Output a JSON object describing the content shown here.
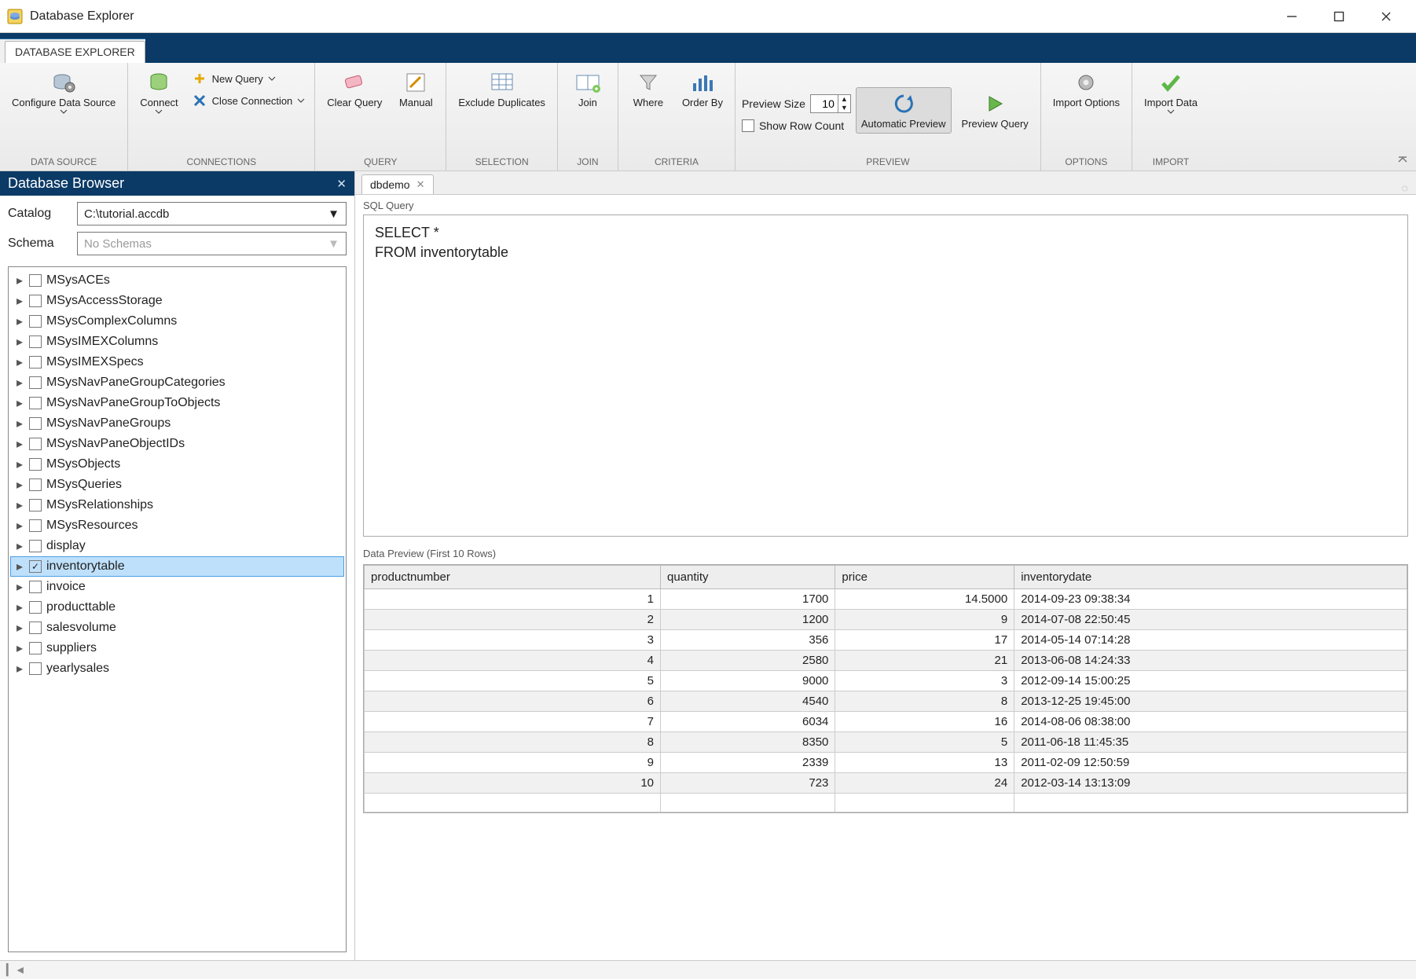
{
  "window": {
    "title": "Database Explorer"
  },
  "main_tab": "DATABASE EXPLORER",
  "ribbon": {
    "configure": "Configure\nData Source",
    "data_source_group": "DATA SOURCE",
    "connect": "Connect",
    "new_query": "New Query",
    "close_connection": "Close Connection",
    "connections_group": "CONNECTIONS",
    "clear_query": "Clear\nQuery",
    "manual": "Manual",
    "query_group": "QUERY",
    "exclude_dup": "Exclude\nDuplicates",
    "selection_group": "SELECTION",
    "join": "Join",
    "join_group": "JOIN",
    "where": "Where",
    "order_by": "Order\nBy",
    "criteria_group": "CRITERIA",
    "preview_size": "Preview Size",
    "preview_size_value": "10",
    "show_row_count": "Show Row Count",
    "automatic_preview": "Automatic\nPreview",
    "preview_query": "Preview\nQuery",
    "preview_group": "PREVIEW",
    "import_options": "Import\nOptions",
    "options_group": "OPTIONS",
    "import_data": "Import\nData",
    "import_group": "IMPORT"
  },
  "browser": {
    "title": "Database Browser",
    "catalog_label": "Catalog",
    "catalog_value": "C:\\tutorial.accdb",
    "schema_label": "Schema",
    "schema_placeholder": "No Schemas",
    "tables": [
      {
        "name": "MSysACEs",
        "checked": false,
        "selected": false
      },
      {
        "name": "MSysAccessStorage",
        "checked": false,
        "selected": false
      },
      {
        "name": "MSysComplexColumns",
        "checked": false,
        "selected": false
      },
      {
        "name": "MSysIMEXColumns",
        "checked": false,
        "selected": false
      },
      {
        "name": "MSysIMEXSpecs",
        "checked": false,
        "selected": false
      },
      {
        "name": "MSysNavPaneGroupCategories",
        "checked": false,
        "selected": false
      },
      {
        "name": "MSysNavPaneGroupToObjects",
        "checked": false,
        "selected": false
      },
      {
        "name": "MSysNavPaneGroups",
        "checked": false,
        "selected": false
      },
      {
        "name": "MSysNavPaneObjectIDs",
        "checked": false,
        "selected": false
      },
      {
        "name": "MSysObjects",
        "checked": false,
        "selected": false
      },
      {
        "name": "MSysQueries",
        "checked": false,
        "selected": false
      },
      {
        "name": "MSysRelationships",
        "checked": false,
        "selected": false
      },
      {
        "name": "MSysResources",
        "checked": false,
        "selected": false
      },
      {
        "name": "display",
        "checked": false,
        "selected": false
      },
      {
        "name": "inventorytable",
        "checked": true,
        "selected": true
      },
      {
        "name": "invoice",
        "checked": false,
        "selected": false
      },
      {
        "name": "producttable",
        "checked": false,
        "selected": false
      },
      {
        "name": "salesvolume",
        "checked": false,
        "selected": false
      },
      {
        "name": "suppliers",
        "checked": false,
        "selected": false
      },
      {
        "name": "yearlysales",
        "checked": false,
        "selected": false
      }
    ]
  },
  "doc": {
    "tab_name": "dbdemo",
    "sql_label": "SQL Query",
    "sql_text": "SELECT *\nFROM inventorytable",
    "preview_label": "Data Preview (First 10 Rows)",
    "columns": [
      "productnumber",
      "quantity",
      "price",
      "inventorydate"
    ],
    "rows": [
      [
        "1",
        "1700",
        "14.5000",
        "2014-09-23 09:38:34"
      ],
      [
        "2",
        "1200",
        "9",
        "2014-07-08 22:50:45"
      ],
      [
        "3",
        "356",
        "17",
        "2014-05-14 07:14:28"
      ],
      [
        "4",
        "2580",
        "21",
        "2013-06-08 14:24:33"
      ],
      [
        "5",
        "9000",
        "3",
        "2012-09-14 15:00:25"
      ],
      [
        "6",
        "4540",
        "8",
        "2013-12-25 19:45:00"
      ],
      [
        "7",
        "6034",
        "16",
        "2014-08-06 08:38:00"
      ],
      [
        "8",
        "8350",
        "5",
        "2011-06-18 11:45:35"
      ],
      [
        "9",
        "2339",
        "13",
        "2011-02-09 12:50:59"
      ],
      [
        "10",
        "723",
        "24",
        "2012-03-14 13:13:09"
      ]
    ]
  }
}
